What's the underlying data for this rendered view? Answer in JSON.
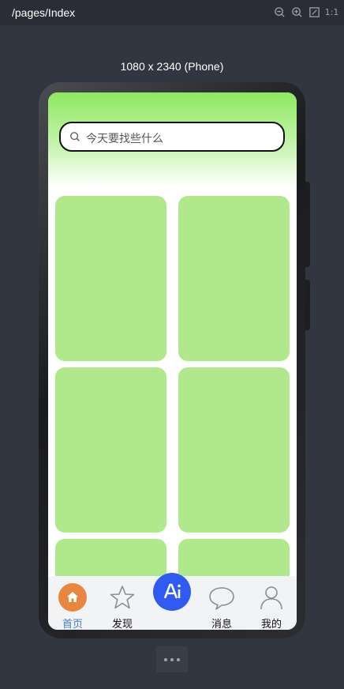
{
  "topbar": {
    "path": "/pages/Index",
    "tools": [
      "zoom-out-icon",
      "zoom-in-icon",
      "fit-screen-icon",
      "1:1"
    ]
  },
  "device": {
    "label": "1080 x 2340 (Phone)"
  },
  "search": {
    "placeholder": "今天要找些什么"
  },
  "cards": [
    {},
    {},
    {},
    {},
    {},
    {}
  ],
  "tabs": [
    {
      "label": "首页",
      "icon": "home-icon",
      "active": true
    },
    {
      "label": "发现",
      "icon": "star-icon",
      "active": false
    },
    {
      "label": "",
      "icon": "ai-icon",
      "active": false
    },
    {
      "label": "消息",
      "icon": "message-icon",
      "active": false
    },
    {
      "label": "我的",
      "icon": "user-icon",
      "active": false
    }
  ],
  "colors": {
    "header_top": "#8ee860",
    "card": "#b0e98c",
    "home_accent": "#e8853e",
    "ai_button": "#2f5bf0",
    "active_tab": "#3d7fd8"
  }
}
